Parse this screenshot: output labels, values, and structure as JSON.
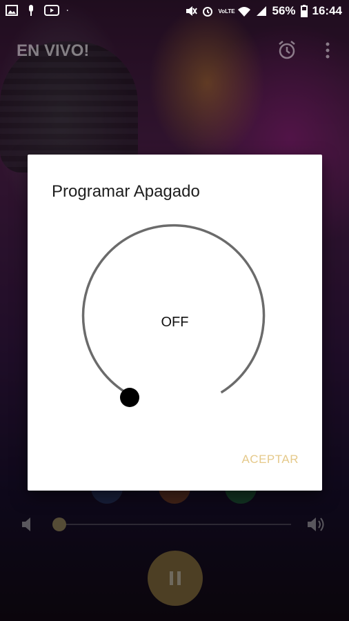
{
  "status_bar": {
    "battery_percent": "56%",
    "time": "16:44",
    "network_label": "VoLTE"
  },
  "app_bar": {
    "title": "EN VIVO!"
  },
  "dialog": {
    "title": "Programar Apagado",
    "timer_value": "OFF",
    "timer_fraction": 0,
    "confirm_label": "ACEPTAR"
  },
  "player": {
    "volume_fraction": 0.0
  },
  "colors": {
    "accent": "#e5c98a",
    "play_button": "#8c7443",
    "dial_ring": "#6b6b6b",
    "dial_knob": "#000000"
  },
  "icons": {
    "statusbar_left": [
      "image-icon",
      "mic-icon",
      "youtube-icon",
      "dot-icon"
    ],
    "statusbar_right": [
      "mute-icon",
      "alarm-icon",
      "volte-icon",
      "wifi-icon",
      "signal-icon",
      "battery-icon"
    ],
    "appbar": [
      "alarm-clock-icon",
      "more-vert-icon"
    ],
    "share": [
      "facebook-icon",
      "share-icon",
      "whatsapp-icon"
    ]
  }
}
